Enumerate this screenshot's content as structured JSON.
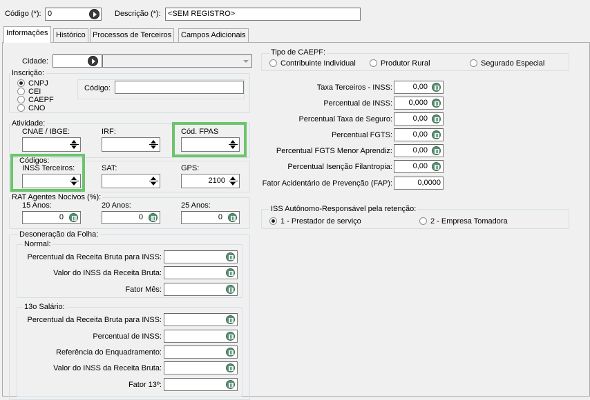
{
  "header": {
    "codigo_label": "Código (*):",
    "codigo_value": "0",
    "descricao_label": "Descrição (*):",
    "descricao_value": "<SEM REGISTRO>"
  },
  "tabs": [
    "Informações",
    "Histórico",
    "Processos de Terceiros",
    "Campos Adicionais"
  ],
  "left": {
    "cidade_label": "Cidade:",
    "inscricao": {
      "title": "Inscrição:",
      "options": [
        "CNPJ",
        "CEI",
        "CAEPF",
        "CNO"
      ],
      "selected": "CNPJ",
      "codigo_label": "Código:"
    },
    "atividade": {
      "title": "Atividade:",
      "cnae_label": "CNAE / IBGE:",
      "irf_label": "IRF:",
      "fpas_label": "Cód. FPAS"
    },
    "codigos": {
      "title": "Códigos:",
      "inss_label": "INSS Terceiros:",
      "sat_label": "SAT:",
      "gps_label": "GPS:",
      "gps_value": "2100"
    },
    "rat": {
      "title": "RAT Agentes Nocivos (%):",
      "a15_label": "15 Anos:",
      "a15_value": "0",
      "a20_label": "20 Anos:",
      "a20_value": "0",
      "a25_label": "25 Anos:",
      "a25_value": "0"
    },
    "desoneracao": {
      "title": "Desoneração da Folha:",
      "normal_title": "Normal:",
      "normal_rows": [
        "Percentual da Receita Bruta para INSS:",
        "Valor do INSS da Receita Bruta:",
        "Fator Mês:"
      ],
      "s13_title": "13o Salário:",
      "s13_rows": [
        "Percentual da Receita Bruta para INSS:",
        "Percentual de INSS:",
        "Referência do Enquadramento:",
        "Valor do INSS da Receita Bruta:",
        "Fator 13º:"
      ]
    }
  },
  "right": {
    "caepf": {
      "title": "Tipo de CAEPF:",
      "options": [
        "Contribuinte Individual",
        "Produtor Rural",
        "Segurado Especial"
      ]
    },
    "fields": [
      {
        "label": "Taxa Terceiros - INSS:",
        "value": "0,00"
      },
      {
        "label": "Percentual de INSS:",
        "value": "0,000"
      },
      {
        "label": "Percentual Taxa de Seguro:",
        "value": "0,00"
      },
      {
        "label": "Percentual FGTS:",
        "value": "0,00"
      },
      {
        "label": "Percentual FGTS Menor Aprendiz:",
        "value": "0,00"
      },
      {
        "label": "Percentual Isenção Filantropia:",
        "value": "0,00"
      },
      {
        "label": "Fator Acidentário de Prevenção (FAP):",
        "value": "0,0000"
      }
    ],
    "iss": {
      "title": "ISS Autônomo-Responsável pela retenção:",
      "options": [
        "1 - Prestador de serviço",
        "2 - Empresa Tomadora"
      ],
      "selected": "1 - Prestador de serviço"
    }
  },
  "colors": {
    "highlight": "#6cc46c",
    "calc_icon": "#5c8f76"
  }
}
